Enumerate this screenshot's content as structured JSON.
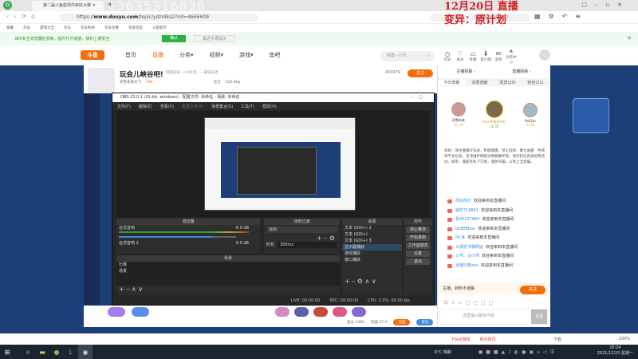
{
  "browser": {
    "tab_title": "第二届斗鱼蓝领中目好大赛",
    "overlay_number": "13635316836",
    "url_prefix": "https://",
    "url_domain": "www.douyu.com",
    "url_path": "/topic/ydzrdks2?rid=4666609",
    "search_hint": "捕捉周边成说2022",
    "bookmarks": [
      "收藏",
      "京东",
      "游戏大全",
      "京东",
      "京东秒杀",
      "京东优惠",
      "淘宝优选",
      "斗鱼新币"
    ],
    "notice": {
      "text": "360安全浏览器检测到，提升打开速度，保护上网安全",
      "confirm": "确认",
      "dismiss": "最近不再提示"
    },
    "status_items": [
      "Flash游戏",
      "热点资讯",
      "下载",
      "100%"
    ]
  },
  "overlay_text": {
    "line1": "12月20日 直播",
    "line2": "变异：原计划"
  },
  "douyu": {
    "logo": "斗鱼",
    "nav": [
      "首页",
      "直播",
      "分类▾",
      "视频▾",
      "游戏▾",
      "鱼吧"
    ],
    "search_placeholder": "经典 - 678",
    "header_icons": [
      {
        "label": "历史",
        "icon": "clock"
      },
      {
        "label": "关注",
        "icon": "heart"
      },
      {
        "label": "开播",
        "icon": "camera"
      },
      {
        "label": "客户端",
        "icon": "download"
      },
      {
        "label": "消息",
        "icon": "bell"
      },
      {
        "label": "创作中心",
        "icon": "bulb"
      }
    ],
    "room": {
      "title": "玩会儿峡谷吧!",
      "category": "网游竞技 • lol云顶... • 最强王者",
      "anchor": "初雪未来文飞",
      "hot": "196",
      "fans_count": "450479",
      "follow": "关注",
      "location": "云汉",
      "weight": "320.6kg"
    },
    "gifts": {
      "hot": "鱼丸 1482",
      "heat": "热度 37.5",
      "btn1": "充值",
      "btn2": "背包"
    }
  },
  "obs": {
    "title": "OBS 23.0.1 (32-bit, windows) - 配置文件: 未命名 - 场景: 未命名",
    "menu": [
      "文件(F)",
      "编辑(E)",
      "查看(V)",
      "配置文件(P)",
      "场景集合(S)",
      "工具(T)",
      "帮助(H)"
    ],
    "mixer": {
      "title": "混音器",
      "ch1": "台式音响",
      "ch1_db": "-6.9 dB",
      "ch2": "台式音响 2",
      "ch2_db": "0.0 dB"
    },
    "transitions": {
      "title": "场景过渡",
      "type": "淡出",
      "duration_label": "时长",
      "duration": "300ms"
    },
    "scenes": {
      "title": "场景",
      "items": [
        "比赛",
        "场景"
      ]
    },
    "sources": {
      "title": "来源",
      "items": [
        "文本 (GDI+) 2",
        "文本 (GDI+)",
        "文本 (GDI+) 3",
        "显示器捕获",
        "游戏捕获",
        "窗口捕获"
      ]
    },
    "controls": {
      "title": "控件",
      "buttons": [
        "停止推流",
        "开始录制",
        "工作室模式",
        "设置",
        "退出"
      ]
    },
    "status": {
      "live": "LIVE: 00:00:00",
      "rec": "REC: 00:00:00",
      "cpu": "CPU: 2.0%, 60.00 fps"
    }
  },
  "right_panel": {
    "links": [
      "主播招募 ›",
      "直播回看 ›"
    ],
    "tabs": [
      "今日贡献",
      "本周贡献",
      "贵宾(20)",
      "粉丝(21)"
    ],
    "top3": [
      {
        "name": "初雪未来",
        "level": "LV 39"
      },
      {
        "name": "bike李福贵木材",
        "level": "LV 31"
      },
      {
        "name": "Ash3cc",
        "level": "LV 16"
      }
    ],
    "notice": "系统：请主播遵守法规，积极健康，禁止低俗、暴力血腥、色情等不良信息，坚决维护网络文明健康环境，请勿轻信各类招聘活动、刷单、兼职及私下交易，谨防诈骗。以免上当受骗。",
    "messages": [
      {
        "user": "风铃风分",
        "text": "欢迎来到本直播间"
      },
      {
        "user": "解忧718891",
        "text": "欢迎来到本直播间"
      },
      {
        "user": "我40127884",
        "text": "欢迎来到本直播间"
      },
      {
        "user": "bb888bbo",
        "text": "欢迎来到本直播间"
      },
      {
        "user": "NC茎",
        "text": "欢迎来到本直播间"
      },
      {
        "user": "大调念卡胸明远",
        "text": "欢迎来到本直播间"
      },
      {
        "user": "三号、马小帅",
        "text": "欢迎来到本直播间"
      },
      {
        "user": "远望归离ans",
        "text": "欢迎来到本直播间"
      }
    ],
    "subscribe_hint": "主播，转粉不迷路",
    "subscribe_btn": "关注",
    "chat_placeholder": "这里输入聊天内容",
    "send": "发送"
  },
  "taskbar": {
    "weather": "6°C 晴朗",
    "time": "20:24",
    "date": "2021/12/20 星期一"
  }
}
